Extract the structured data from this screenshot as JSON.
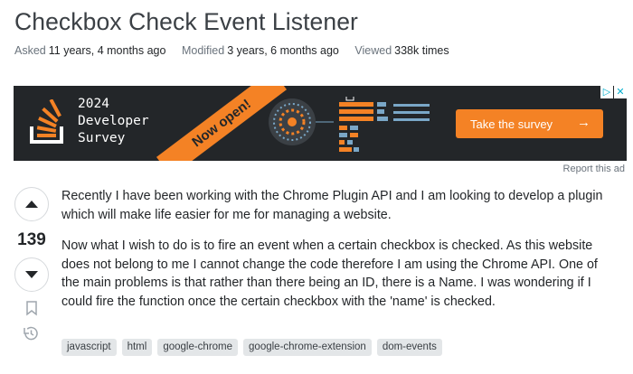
{
  "question": {
    "title": "Checkbox Check Event Listener",
    "meta": {
      "asked_label": "Asked",
      "asked_value": "11 years, 4 months ago",
      "modified_label": "Modified",
      "modified_value": "3 years, 6 months ago",
      "viewed_label": "Viewed",
      "viewed_value": "338k times"
    },
    "score": "139",
    "body": [
      "Recently I have been working with the Chrome Plugin API and I am looking to develop a plugin which will make life easier for me for managing a website.",
      "Now what I wish to do is to fire an event when a certain checkbox is checked. As this website does not belong to me I cannot change the code therefore I am using the Chrome API. One of the main problems is that rather than there being an ID, there is a Name. I was wondering if I could fire the function once the certain checkbox with the 'name' is checked."
    ],
    "tags": [
      "javascript",
      "html",
      "google-chrome",
      "google-chrome-extension",
      "dom-events"
    ]
  },
  "ad": {
    "year": "2024",
    "line2": "Developer",
    "line3": "Survey",
    "ribbon": "Now open!",
    "button_label": "Take the survey",
    "button_arrow": "→",
    "report_label": "Report this ad",
    "accent_color": "#f48225",
    "background_color": "#232629"
  },
  "icons": {
    "upvote": "upvote-arrow-icon",
    "downvote": "downvote-arrow-icon",
    "bookmark": "bookmark-icon",
    "history": "history-icon",
    "logo": "stackoverflow-logo-icon",
    "adchoices": "adchoices-icon",
    "close": "close-icon"
  }
}
